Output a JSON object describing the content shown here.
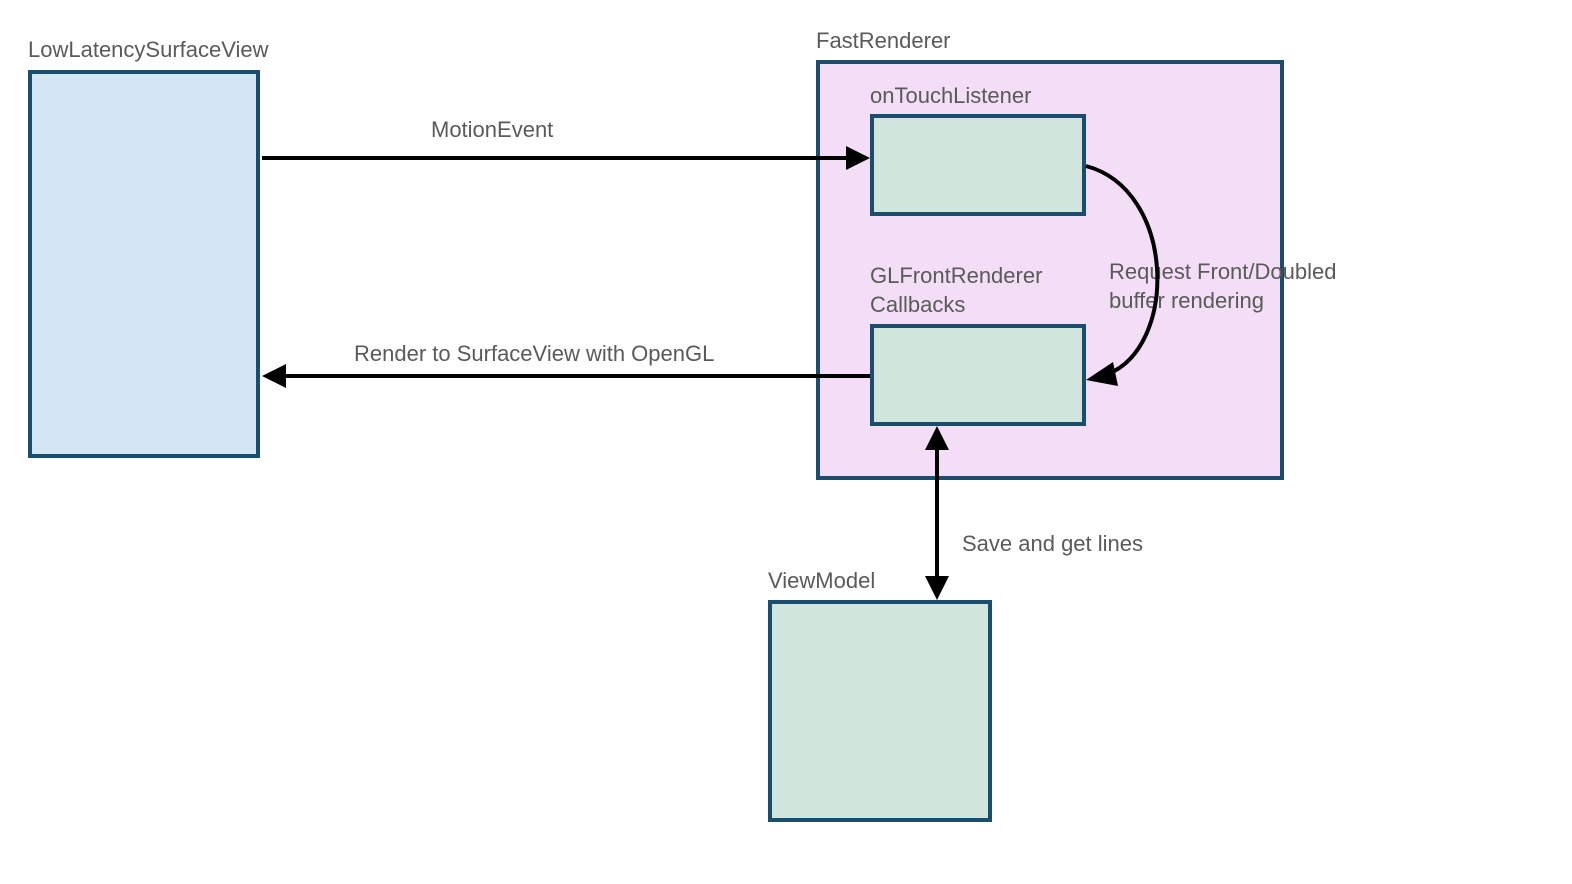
{
  "boxes": {
    "lowLatency": {
      "label": "LowLatencySurfaceView"
    },
    "fastRenderer": {
      "label": "FastRenderer"
    },
    "onTouch": {
      "label": "onTouchListener"
    },
    "glFront": {
      "label": "GLFrontRenderer Callbacks"
    },
    "viewModel": {
      "label": "ViewModel"
    }
  },
  "arrows": {
    "motionEvent": {
      "label": "MotionEvent"
    },
    "renderOpenGL": {
      "label": "Render to SurfaceView with OpenGL"
    },
    "requestBuffer": {
      "label": "Request Front/Doubled buffer rendering"
    },
    "saveLines": {
      "label": "Save and get lines"
    }
  },
  "colors": {
    "lightBlue": "#d4e6f4",
    "lightPurple": "#f4ddf7",
    "lightGreen": "#d0e5db",
    "border": "#1a4d6e"
  }
}
